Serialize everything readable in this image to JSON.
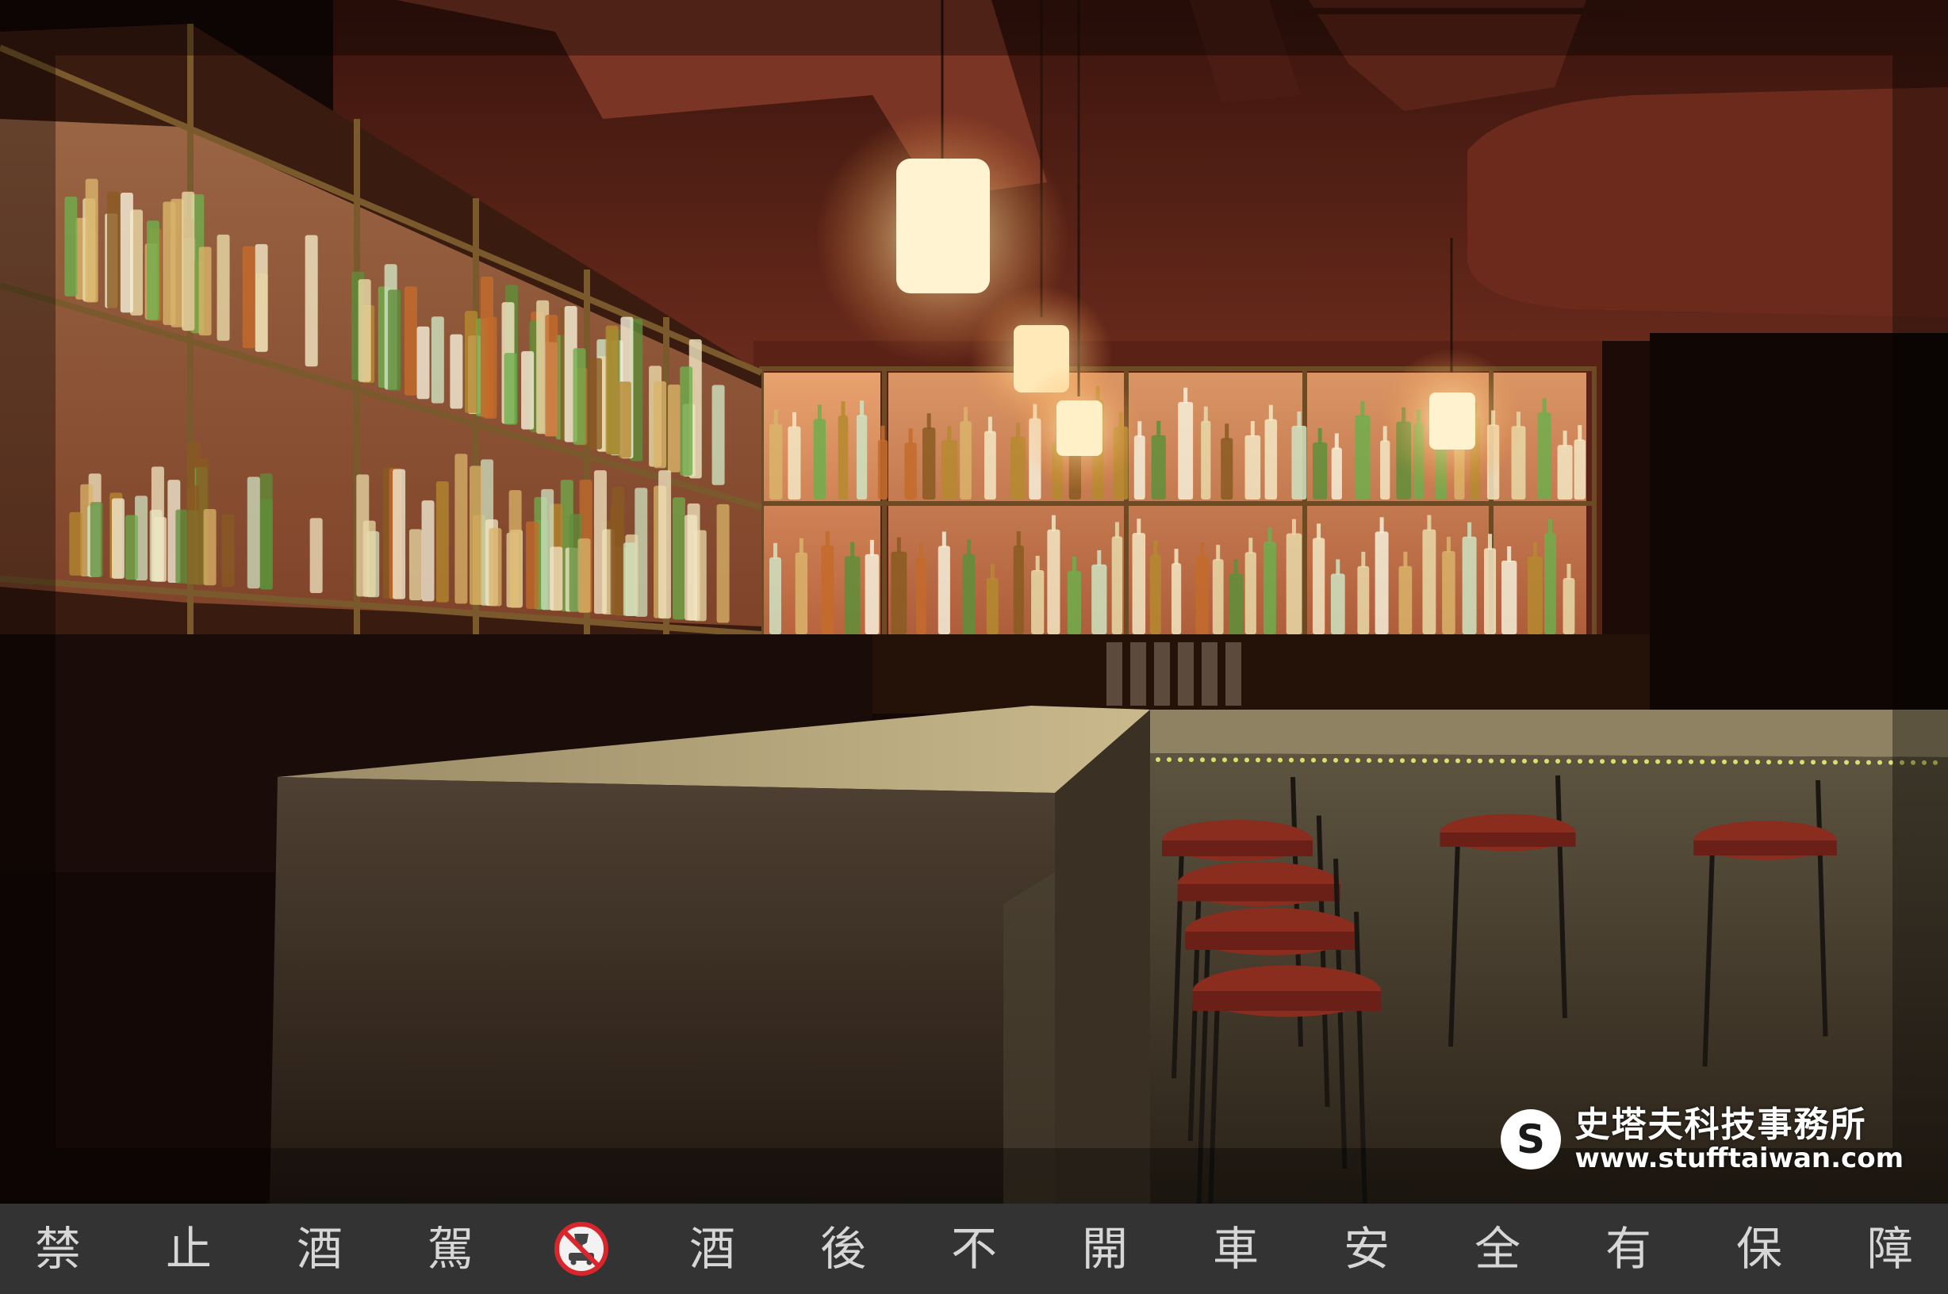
{
  "watermark": {
    "logo_letter": "S",
    "name": "史塔夫科技事務所",
    "url": "www.stufftaiwan.com"
  },
  "banner": {
    "chars_left": [
      "禁",
      "止",
      "酒",
      "駕"
    ],
    "icon": "no-drink-driving-icon",
    "chars_right": [
      "酒",
      "後",
      "不",
      "開",
      "車",
      "安",
      "全",
      "有",
      "保",
      "障"
    ]
  },
  "colors": {
    "banner_bg": "#333333",
    "banner_text": "#d6d6d6",
    "icon_red": "#d9262c"
  }
}
